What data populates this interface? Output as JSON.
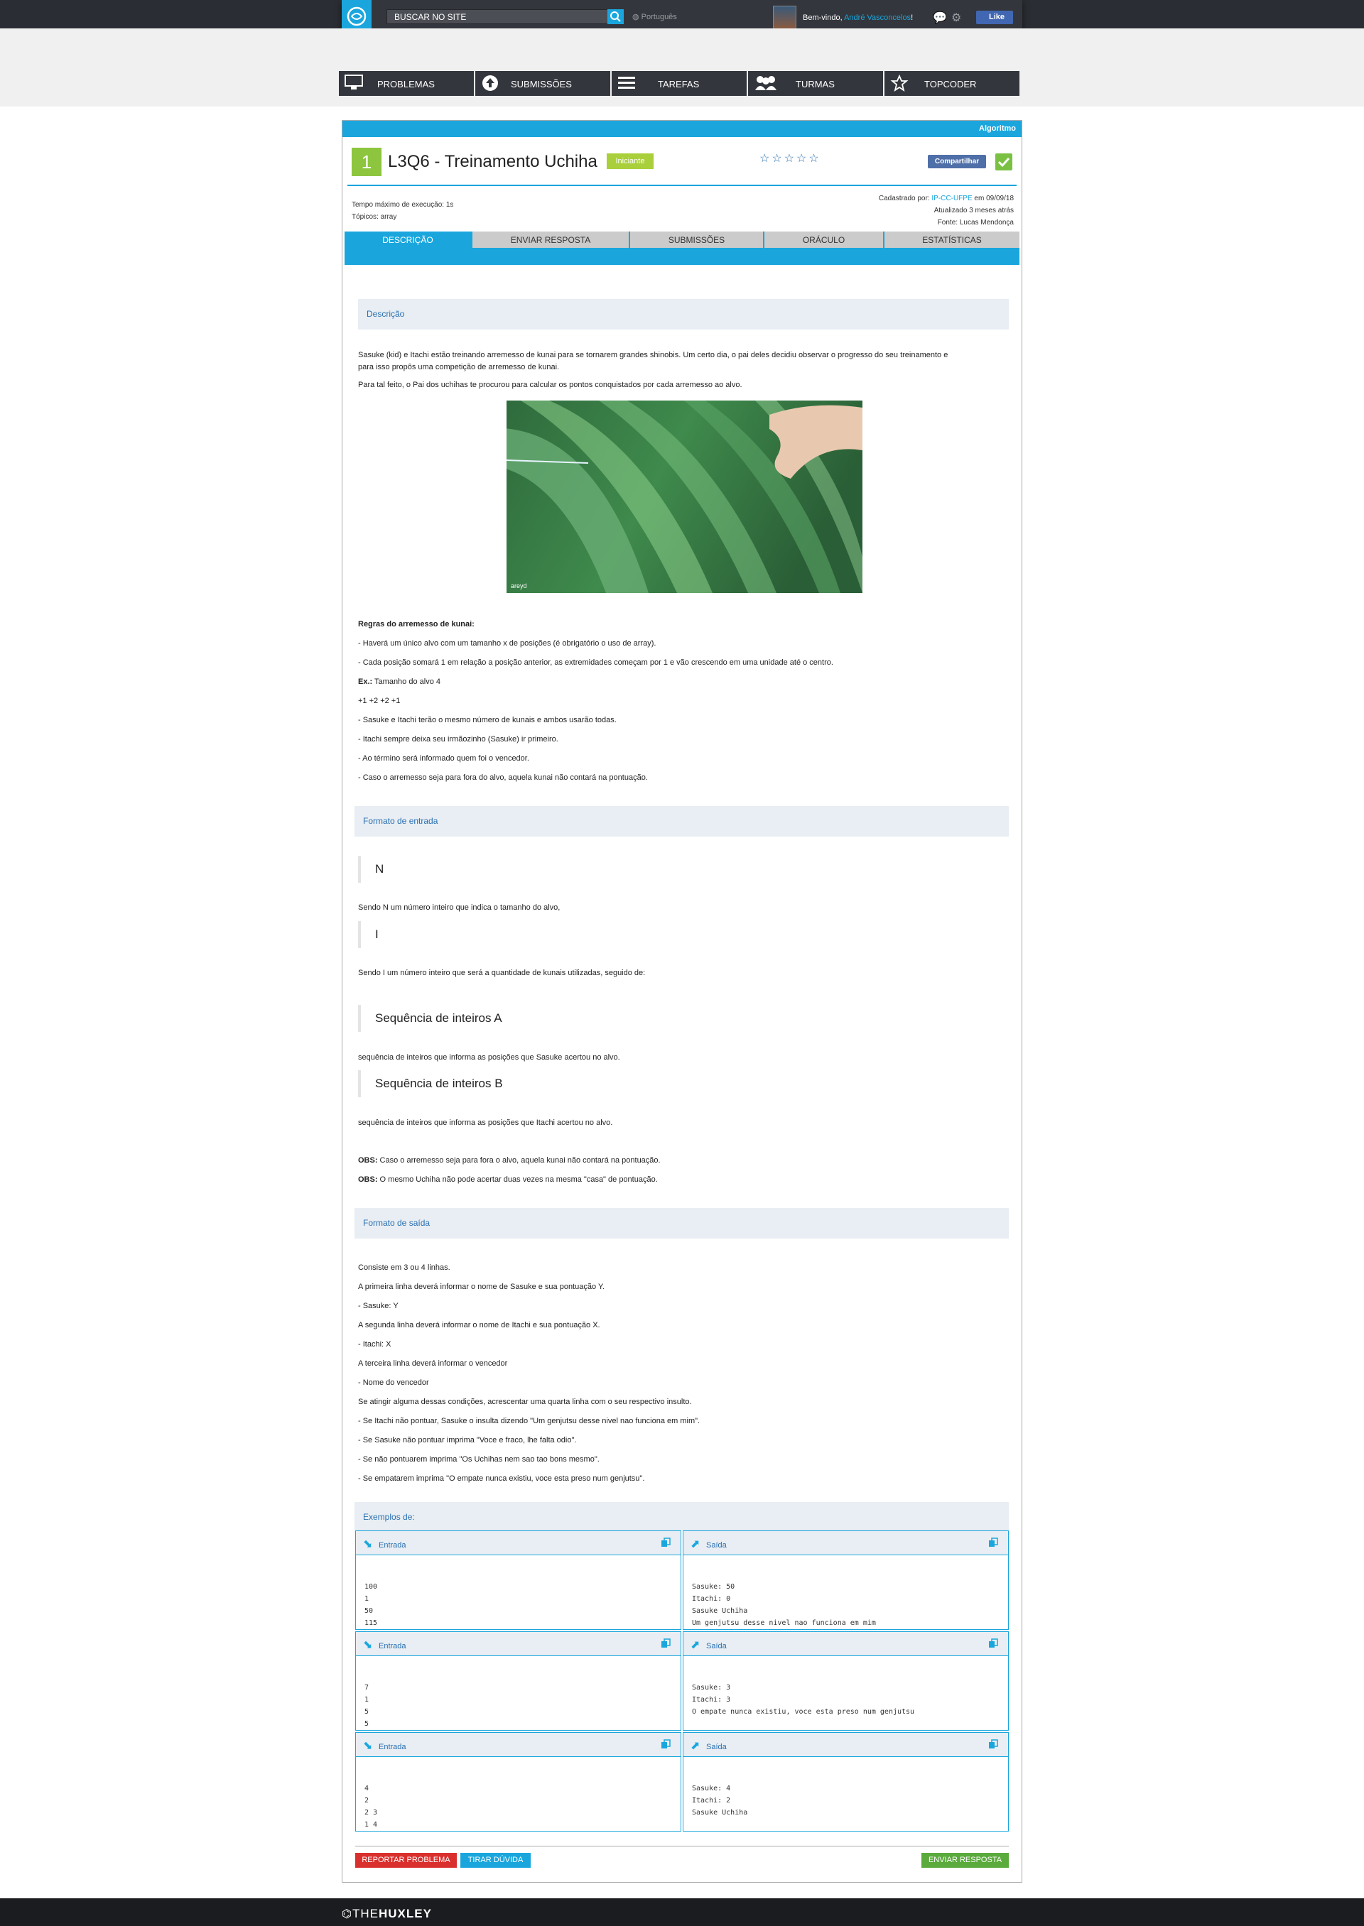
{
  "header": {
    "search_placeholder": "BUSCAR NO SITE",
    "language": "Português",
    "welcome_prefix": "Bem-vindo, ",
    "user_name": "André Vasconcelos",
    "welcome_suffix": "!",
    "like_label": "Like"
  },
  "nav": [
    {
      "label": "PROBLEMAS",
      "icon": "monitor-icon"
    },
    {
      "label": "SUBMISSÕES",
      "icon": "upload-icon"
    },
    {
      "label": "TAREFAS",
      "icon": "list-icon"
    },
    {
      "label": "TURMAS",
      "icon": "group-icon"
    },
    {
      "label": "TOPCODER",
      "icon": "star-icon"
    }
  ],
  "problem": {
    "type": "Algoritmo",
    "level": "1",
    "title": "L3Q6 - Treinamento Uchiha",
    "difficulty": "Iniciante",
    "stars": "☆☆☆☆☆",
    "share_label": "Compartilhar",
    "time_limit": "Tempo máximo de execução: 1s",
    "topics": "Tópicos: array",
    "registered_prefix": "Cadastrado por: ",
    "registered_by": "IP-CC-UFPE",
    "registered_date": " em 09/09/18",
    "updated": "Atualizado 3 meses atrás",
    "source": "Fonte: Lucas Mendonça"
  },
  "tabs": [
    "DESCRIÇÃO",
    "ENVIAR RESPOSTA",
    "SUBMISSÕES",
    "ORÁCULO",
    "ESTATÍSTICAS"
  ],
  "description": {
    "header": "Descrição",
    "p1a": "Sasuke (kid) e Itachi estão treinando arremesso de kunai para se tornarem grandes shinobis. Um certo dia, o pai deles decidiu observar o progresso do seu treinamento e",
    "p1b": "para isso propôs uma competição de arremesso de kunai.",
    "p2": "Para tal feito, o Pai dos uchihas te procurou para calcular os pontos conquistados por cada arremesso ao alvo.",
    "image_credit": "areyd",
    "rules_title": "Regras do arremesso de kunai:",
    "r1": "- Haverá um único alvo com um tamanho x de posições (é obrigatório o uso de array).",
    "r2": "- Cada posição somará 1 em relação a posição anterior, as extremidades começam por 1 e vão crescendo em uma unidade até o centro.",
    "ex_label": "Ex.:",
    "ex_text": " Tamanho do alvo 4",
    "ex_seq": "+1 +2 +2 +1",
    "r3": "- Sasuke e Itachi terão o mesmo número de kunais e ambos usarão todas.",
    "r4": "- Itachi sempre deixa seu irmãozinho (Sasuke) ir primeiro.",
    "r5": "- Ao término será informado quem foi o vencedor.",
    "r6": "- Caso o arremesso seja para fora do alvo, aquela kunai não contará na pontuação."
  },
  "input_format": {
    "header": "Formato de entrada",
    "q1": "N",
    "t1": "Sendo N um número inteiro que indica o tamanho do alvo,",
    "q2": "I",
    "t2": "Sendo I um número inteiro que será a quantidade de kunais utilizadas, seguido de:",
    "q3": "Sequência de inteiros A",
    "t3": "sequência de inteiros que informa as posições que Sasuke acertou no alvo.",
    "q4": "Sequência de inteiros B",
    "t4": "sequência de inteiros que informa as posições que Itachi acertou no alvo.",
    "obs_label": "OBS:",
    "obs1": " Caso o arremesso seja para fora o alvo, aquela kunai não contará na pontuação.",
    "obs2": " O mesmo Uchiha não pode acertar duas vezes na mesma \"casa\" de pontuação."
  },
  "output_format": {
    "header": "Formato de saída",
    "lines": [
      "Consiste em 3 ou 4 linhas.",
      "A primeira linha deverá informar o nome de Sasuke e sua pontuação Y.",
      "- Sasuke: Y",
      "A segunda linha deverá informar o nome de Itachi e sua pontuação X.",
      "- Itachi: X",
      "A terceira linha deverá informar o vencedor",
      "- Nome do vencedor",
      "Se atingir alguma dessas condições, acrescentar uma quarta linha com o seu respectivo insulto.",
      "- Se Itachi não pontuar, Sasuke o insulta dizendo \"Um genjutsu desse nivel nao funciona em mim\".",
      "- Se Sasuke não pontuar imprima \"Voce e fraco, lhe falta odio\".",
      "- Se não pontuarem imprima \"Os Uchihas nem sao tao bons mesmo\".",
      "- Se empatarem imprima \"O empate nunca existiu, voce esta preso num genjutsu\"."
    ]
  },
  "examples": {
    "header": "Exemplos de:",
    "input_label": "Entrada",
    "output_label": "Saída",
    "items": [
      {
        "input": "100\n1\n50\n115",
        "output": "Sasuke: 50\nItachi: 0\nSasuke Uchiha\nUm genjutsu desse nivel nao funciona em mim"
      },
      {
        "input": "7\n1\n5\n5",
        "output": "Sasuke: 3\nItachi: 3\nO empate nunca existiu, voce esta preso num genjutsu"
      },
      {
        "input": "4\n2\n2 3\n1 4",
        "output": "Sasuke: 4\nItachi: 2\nSasuke Uchiha"
      }
    ]
  },
  "buttons": {
    "report": "REPORTAR PROBLEMA",
    "ask": "TIRAR DÚVIDA",
    "submit": "ENVIAR RESPOSTA"
  },
  "footer": {
    "logo_the": "THE",
    "logo_huxley": "HUXLEY"
  },
  "colors": {
    "accent": "#1aa6dd",
    "level_green": "#8dc53e",
    "report_red": "#d9302e",
    "submit_green": "#5aaa3c"
  }
}
